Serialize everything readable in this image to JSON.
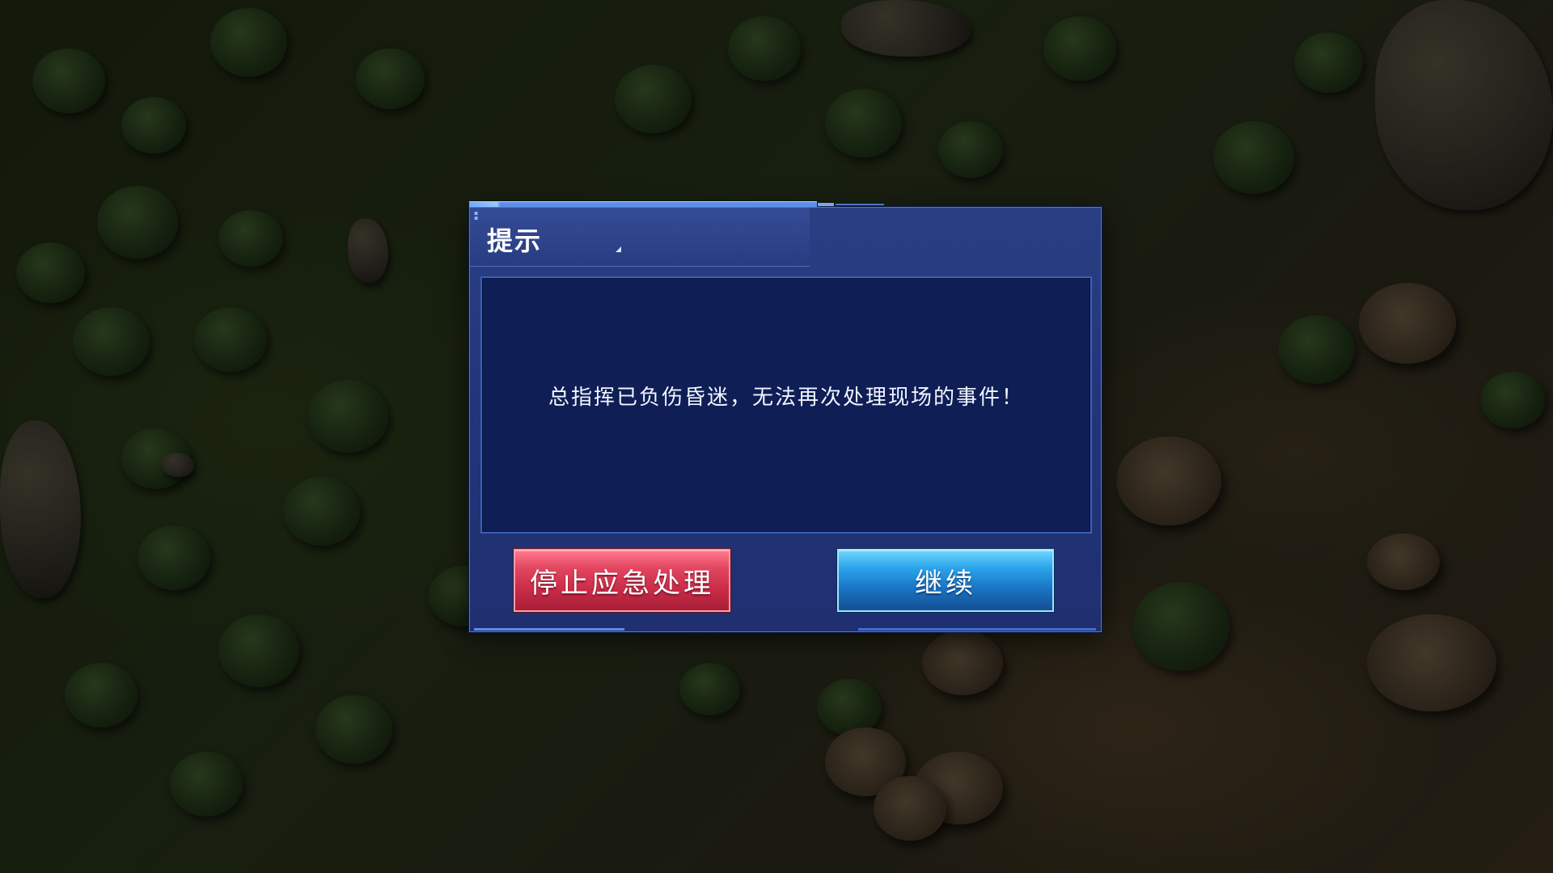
{
  "dialog": {
    "title": "提示",
    "message": "总指挥已负伤昏迷，无法再次处理现场的事件！",
    "stop_button_label": "停止应急处理",
    "continue_button_label": "继续"
  },
  "colors": {
    "dialog_bg": "#23357a",
    "message_panel_bg": "#0f1e55",
    "stop_button": "#c52944",
    "continue_button": "#1a72c2"
  }
}
